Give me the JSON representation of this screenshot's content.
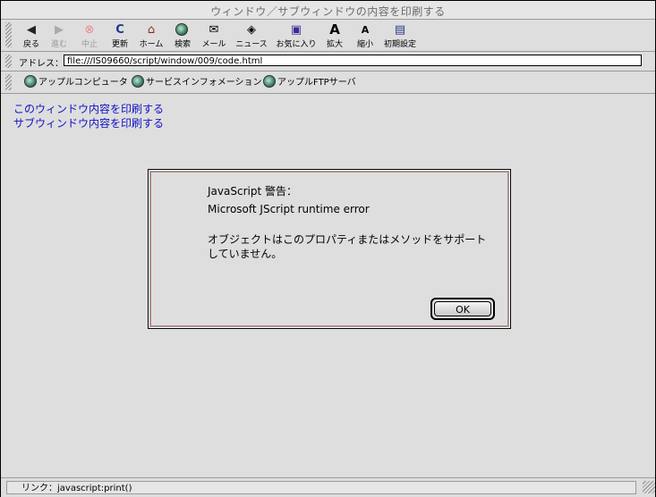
{
  "window": {
    "title": "ウィンドウ／サブウィンドウの内容を印刷する"
  },
  "toolbar": {
    "buttons": [
      {
        "label": "戻る",
        "icon": "◆"
      },
      {
        "label": "進む",
        "icon": "◆"
      },
      {
        "label": "中止",
        "icon": "⊗"
      },
      {
        "label": "更新",
        "icon": "↻"
      },
      {
        "label": "ホーム",
        "icon": "⌂"
      },
      {
        "label": "検索",
        "icon": "◍"
      },
      {
        "label": "メール",
        "icon": "✉"
      },
      {
        "label": "ニュース",
        "icon": "◈"
      },
      {
        "label": "お気に入り",
        "icon": "▣"
      },
      {
        "label": "拡大",
        "icon": "A"
      },
      {
        "label": "縮小",
        "icon": "A"
      },
      {
        "label": "初期設定",
        "icon": "▤"
      }
    ]
  },
  "address": {
    "label": "アドレス：",
    "url": "file:///IS09660/script/window/009/code.html"
  },
  "links": [
    {
      "label": "アップルコンピュータ"
    },
    {
      "label": "サービスインフォメーション"
    },
    {
      "label": "アップルFTPサーバ"
    }
  ],
  "page": {
    "link1": "このウィンドウ内容を印刷する",
    "link2": "サブウィンドウ内容を印刷する"
  },
  "dialog": {
    "title": "JavaScript 警告：",
    "error": "Microsoft JScript runtime error",
    "message_line1": "オブジェクトはこのプロパティまたはメソッドをサポート",
    "message_line2": "していません。",
    "ok_label": "OK"
  },
  "status": {
    "text": "リンク：javascript:print()"
  }
}
